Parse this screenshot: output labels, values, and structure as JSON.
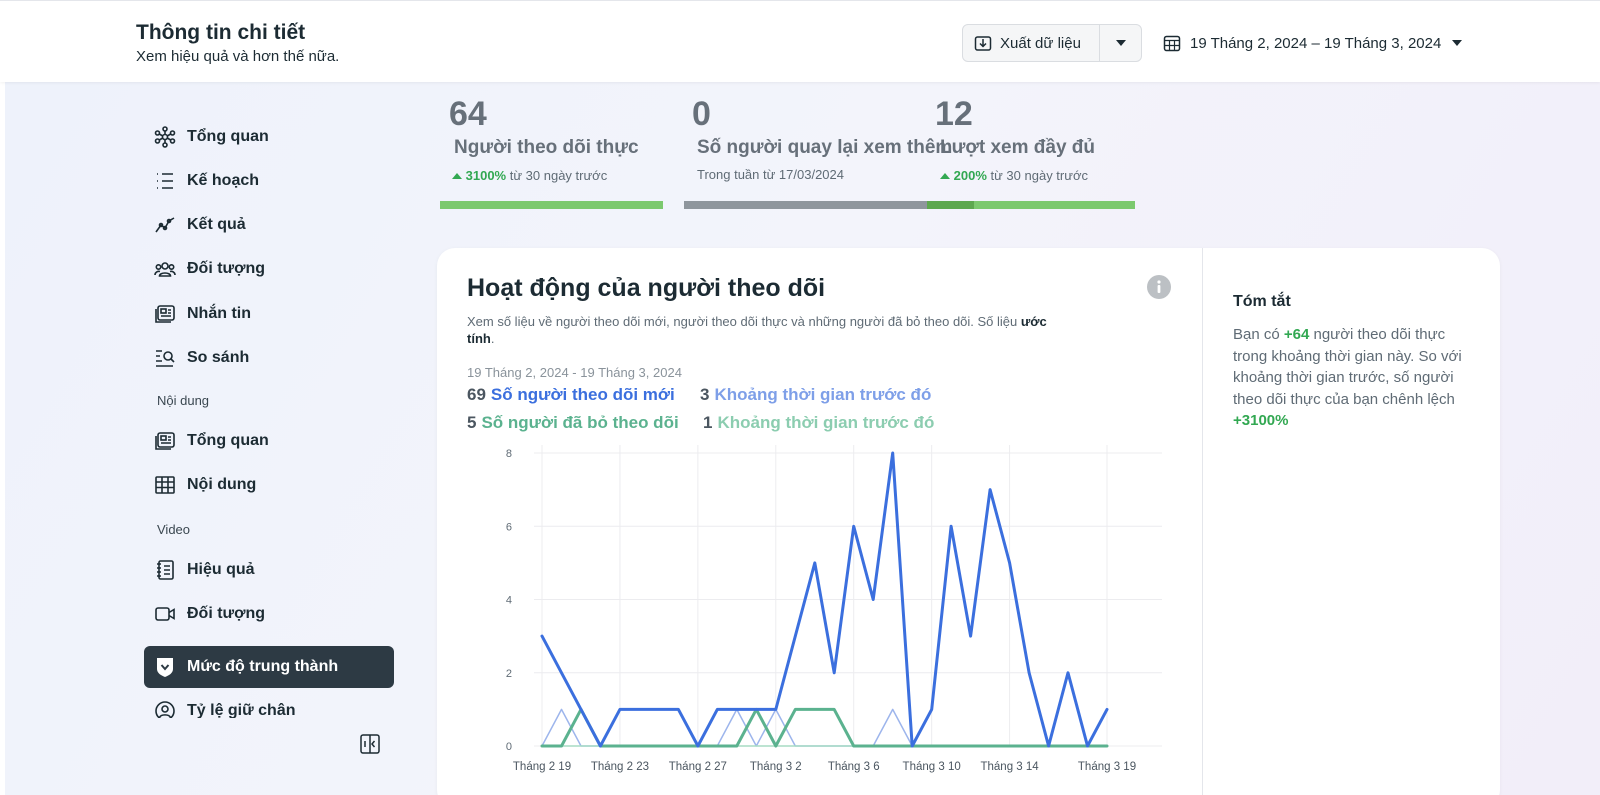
{
  "header": {
    "title": "Thông tin chi tiết",
    "subtitle": "Xem hiệu quả và hơn thế nữa.",
    "export_label": "Xuất dữ liệu",
    "date_range": "19 Tháng 2, 2024 – 19 Tháng 3, 2024"
  },
  "sidebar": {
    "items_top": [
      {
        "label": "Tổng quan",
        "icon": "network-icon"
      },
      {
        "label": "Kế hoạch",
        "icon": "list-icon"
      },
      {
        "label": "Kết quả",
        "icon": "trend-icon"
      },
      {
        "label": "Đối tượng",
        "icon": "people-icon"
      },
      {
        "label": "Nhắn tin",
        "icon": "message-icon"
      },
      {
        "label": "So sánh",
        "icon": "compare-icon"
      }
    ],
    "section_content": "Nội dung",
    "items_content": [
      {
        "label": "Tổng quan",
        "icon": "content-overview-icon"
      },
      {
        "label": "Nội dung",
        "icon": "table-icon"
      }
    ],
    "section_video": "Video",
    "items_video": [
      {
        "label": "Hiệu quả",
        "icon": "notebook-icon"
      },
      {
        "label": "Đối tượng",
        "icon": "video-icon"
      },
      {
        "label": "Mức độ trung thành",
        "icon": "badge-icon",
        "active": true
      },
      {
        "label": "Tỷ lệ giữ chân",
        "icon": "user-circle-icon"
      }
    ]
  },
  "metrics": [
    {
      "value": "64",
      "label": "Người theo dõi thực",
      "pct": "3100%",
      "suffix": "từ 30 ngày trước"
    },
    {
      "value": "0",
      "label": "Số người quay lại xem thêm",
      "sub": "Trong tuần từ 17/03/2024"
    },
    {
      "value": "12",
      "label": "Lượt xem đầy đủ",
      "pct": "200%",
      "suffix": "từ 30 ngày trước"
    }
  ],
  "card": {
    "title": "Hoạt động của người theo dõi",
    "description_pre": "Xem số liệu về người theo dõi mới, người theo dõi thực và những người đã bỏ theo dõi. Số liệu ",
    "description_bold": "ước tính",
    "description_post": ".",
    "range": "19 Tháng 2, 2024 - 19 Tháng 3, 2024",
    "legend": [
      {
        "value": "69",
        "label": "Số người theo dõi mới",
        "color": "#3b6fde"
      },
      {
        "value": "3",
        "label": "Khoảng thời gian trước đó",
        "color": "#7e9fe8"
      },
      {
        "value": "5",
        "label": "Số người đã bỏ theo dõi",
        "color": "#5bb28f"
      },
      {
        "value": "1",
        "label": "Khoảng thời gian trước đó",
        "color": "#8ccdb0"
      }
    ]
  },
  "summary": {
    "title": "Tóm tắt",
    "text_1": "Bạn có ",
    "highlight_1": "+64",
    "text_2": " người theo dõi thực trong khoảng thời gian này. So với khoảng thời gian trước, số người theo dõi thực của bạn chênh lệch ",
    "highlight_2": "+3100%"
  },
  "chart_data": {
    "type": "line",
    "x": [
      "Tháng 2 19",
      "Tháng 2 20",
      "Tháng 2 21",
      "Tháng 2 22",
      "Tháng 2 23",
      "Tháng 2 24",
      "Tháng 2 25",
      "Tháng 2 26",
      "Tháng 2 27",
      "Tháng 2 28",
      "Tháng 2 29",
      "Tháng 3 1",
      "Tháng 3 2",
      "Tháng 3 3",
      "Tháng 3 4",
      "Tháng 3 5",
      "Tháng 3 6",
      "Tháng 3 7",
      "Tháng 3 8",
      "Tháng 3 9",
      "Tháng 3 10",
      "Tháng 3 11",
      "Tháng 3 12",
      "Tháng 3 13",
      "Tháng 3 14",
      "Tháng 3 15",
      "Tháng 3 16",
      "Tháng 3 17",
      "Tháng 3 18",
      "Tháng 3 19"
    ],
    "x_tick_labels": [
      "Tháng 2 19",
      "Tháng 2 23",
      "Tháng 2 27",
      "Tháng 3 2",
      "Tháng 3 6",
      "Tháng 3 10",
      "Tháng 3 14",
      "Tháng 3 19"
    ],
    "y_ticks": [
      0,
      2,
      4,
      6,
      8
    ],
    "ylim": [
      0,
      8
    ],
    "grid": true,
    "series": [
      {
        "name": "Khoảng thời gian trước đó",
        "color": "#9db5ec",
        "width": 1.5,
        "values": [
          0,
          1,
          0,
          0,
          0,
          0,
          0,
          0,
          0,
          0,
          1,
          0,
          1,
          0,
          0,
          0,
          0,
          0,
          1,
          0,
          0,
          0,
          0,
          0,
          0,
          0,
          0,
          0,
          0,
          0
        ]
      },
      {
        "name": "Khoảng thời gian trước đó",
        "color": "#a7dcc4",
        "width": 1.5,
        "values": [
          0,
          0,
          0,
          0,
          0,
          0,
          0,
          0,
          0,
          0,
          0,
          0,
          0,
          0,
          0,
          0,
          0,
          0,
          0,
          0,
          0,
          0,
          0,
          0,
          0,
          0,
          0,
          0,
          0,
          0
        ]
      },
      {
        "name": "Số người đã bỏ theo dõi",
        "color": "#5bb28f",
        "width": 3,
        "values": [
          0,
          0,
          1,
          0,
          0,
          0,
          0,
          0,
          0,
          0,
          0,
          1,
          0,
          1,
          1,
          1,
          0,
          0,
          0,
          0,
          0,
          0,
          0,
          0,
          0,
          0,
          0,
          0,
          0,
          0
        ]
      },
      {
        "name": "Số người theo dõi mới",
        "color": "#3b6fde",
        "width": 3,
        "values": [
          3,
          2,
          1,
          0,
          1,
          1,
          1,
          1,
          0,
          1,
          1,
          1,
          1,
          3,
          5,
          2,
          6,
          4,
          8,
          0,
          1,
          6,
          3,
          7,
          5,
          2,
          0,
          2,
          0,
          1
        ]
      }
    ]
  }
}
